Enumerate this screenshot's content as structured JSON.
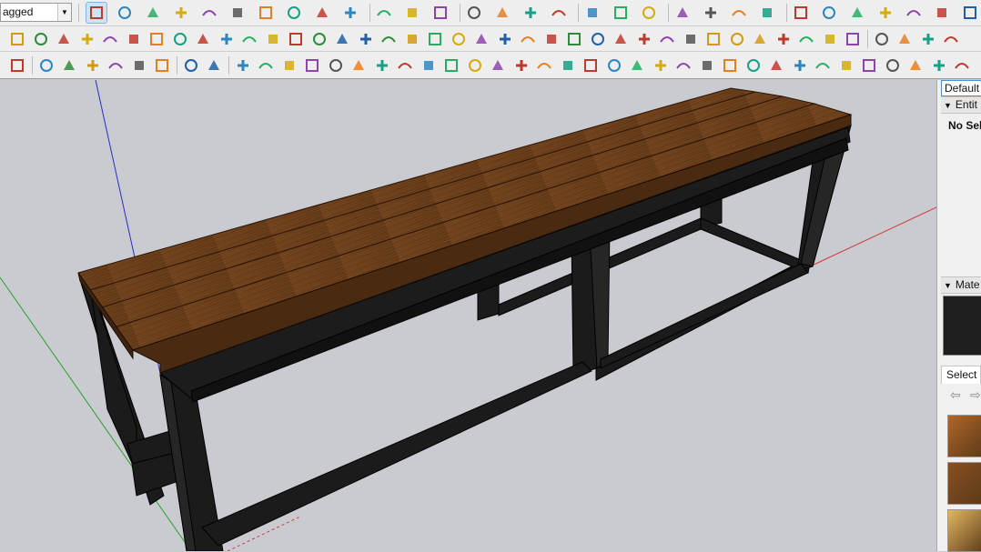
{
  "toolbar": {
    "tag_value": "agged",
    "row1_icons": [
      "select-arrow",
      "eraser",
      "pencil-line",
      "arc",
      "shape-rectangle",
      "push-pull",
      "follow-me",
      "move",
      "rotate",
      "scale",
      "tape-measure",
      "text-label",
      "paint-bucket",
      "orbit",
      "pan",
      "zoom",
      "zoom-extents",
      "warehouse",
      "extension-warehouse",
      "layout",
      "sandbox",
      "account",
      "house-iso",
      "house-front",
      "house",
      "house-outline",
      "house-door",
      "layers-1",
      "layers-2",
      "layers-red",
      "layers-blue"
    ],
    "row2_icons": [
      "plane-yellow",
      "plane-green",
      "plane-red",
      "plane-outline",
      "spiral",
      "square-red",
      "panel",
      "flag",
      "box-wood",
      "link",
      "curve-path",
      "dots-curve",
      "plus-red",
      "plus-green",
      "cross-blue",
      "cone-cyan",
      "pyramid-green",
      "triangle-yellow",
      "horseshoe",
      "stairs",
      "ring",
      "star-cyan",
      "cube-brown",
      "magnet-red",
      "puzzle-green",
      "move-blue",
      "pipes-red",
      "gear-red",
      "flower",
      "frame",
      "grid-orange",
      "grid-yellow",
      "grid-yellow-2",
      "scatter-red",
      "dots-arc",
      "dotted-grid",
      "chairs",
      "doc-1",
      "doc-2",
      "doc-3",
      "doc-4"
    ],
    "row3_icons": [
      "film-camera",
      "add-circle",
      "tree-green",
      "sun-gradient",
      "checker-sphere",
      "cloud-upload",
      "settings-gear",
      "mail",
      "info",
      "curve-1",
      "curve-2",
      "curve-3",
      "scissors",
      "blob",
      "blob-outline",
      "tube",
      "shell",
      "knot",
      "hook",
      "corner-1",
      "corner-2",
      "slash-red",
      "corner-3",
      "cup",
      "triangle-outline",
      "spring",
      "coil",
      "hand",
      "leaf",
      "sweep",
      "fan",
      "slope",
      "chevrons",
      "branch",
      "arrows",
      "dome",
      "stairs-2",
      "round",
      "hook-2",
      "edge",
      "stretch"
    ]
  },
  "tray": {
    "tab_label": "Default",
    "entity_header": "Entit",
    "no_selection": "No Sele",
    "materials_header": "Mate",
    "select_tab": "Select",
    "swatches": [
      "#b0652a",
      "#8a4f22",
      "#e3b762"
    ]
  },
  "model": {
    "wood_color": "#6b3f1c",
    "wood_light": "#7d4b23",
    "frame_color": "#1a1a1a"
  }
}
